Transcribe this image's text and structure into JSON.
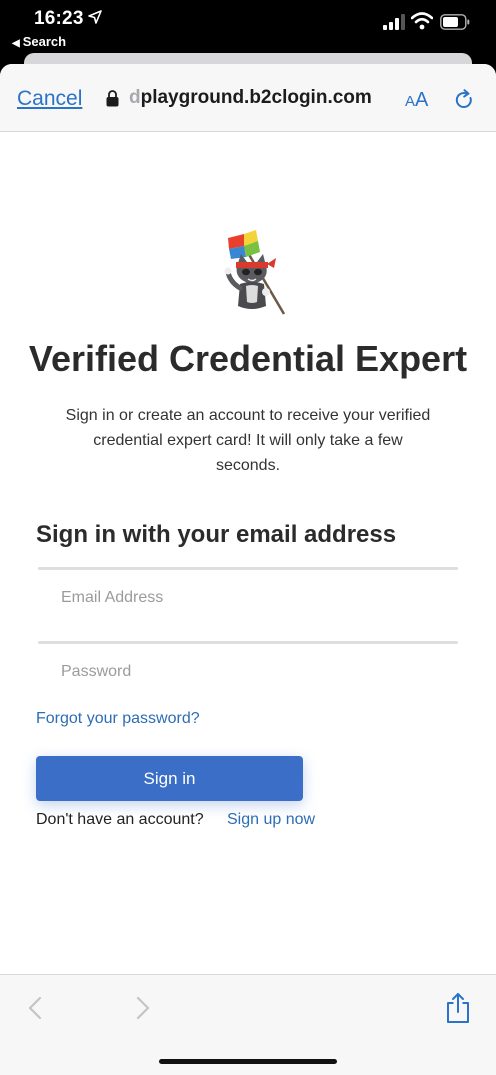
{
  "status": {
    "time": "16:23",
    "back_app": "Search"
  },
  "navbar": {
    "cancel": "Cancel",
    "url_prefix": "d",
    "url_domain": "playground.b2clogin.com",
    "text_size_small": "A",
    "text_size_large": "A"
  },
  "content": {
    "title": "Verified Credential Expert",
    "description": "Sign in or create an account to receive your verified credential expert card! It will only take a few seconds.",
    "heading": "Sign in with your email address",
    "email_placeholder": "Email Address",
    "password_placeholder": "Password",
    "forgot": "Forgot your password?",
    "signin": "Sign in",
    "no_account": "Don't have an account?",
    "signup": "Sign up now"
  },
  "colors": {
    "accent": "#2a73c9",
    "button": "#3a6ec7",
    "link": "#2d6db5"
  },
  "icons": [
    "location-arrow-icon",
    "signal-icon",
    "wifi-icon",
    "battery-icon",
    "lock-icon",
    "reload-icon",
    "back-icon",
    "forward-icon",
    "share-icon",
    "mascot-logo"
  ]
}
